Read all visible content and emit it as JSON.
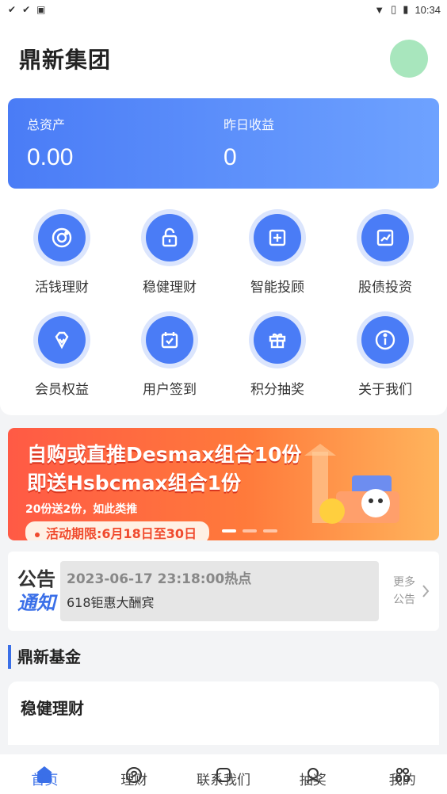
{
  "status_bar": {
    "time": "10:34"
  },
  "header": {
    "title": "鼎新集团"
  },
  "assets": {
    "total_label": "总资产",
    "total_value": "0.00",
    "yesterday_label": "昨日收益",
    "yesterday_value": "0"
  },
  "grid": {
    "items": [
      {
        "label": "活钱理财",
        "icon": "coin-icon"
      },
      {
        "label": "稳健理财",
        "icon": "lock-icon"
      },
      {
        "label": "智能投顾",
        "icon": "plus-box-icon"
      },
      {
        "label": "股债投资",
        "icon": "chart-up-icon"
      },
      {
        "label": "会员权益",
        "icon": "diamond-icon"
      },
      {
        "label": "用户签到",
        "icon": "calendar-check-icon"
      },
      {
        "label": "积分抽奖",
        "icon": "gift-icon"
      },
      {
        "label": "关于我们",
        "icon": "info-icon"
      }
    ]
  },
  "banner": {
    "line1": "自购或直推Desmax组合10份",
    "line2": "即送Hsbcmax组合1份",
    "sub": "20份送2份，如此类推",
    "period": "活动期限:6月18日至30日"
  },
  "notice": {
    "logo_a": "公告",
    "logo_b": "通知",
    "time": "2023-06-17 23:18:00热点",
    "text": "618钜惠大酬宾",
    "more_1": "更多",
    "more_2": "公告"
  },
  "section": {
    "title": "鼎新基金"
  },
  "product": {
    "title": "稳健理财"
  },
  "tabbar": {
    "tabs": [
      {
        "label": "首页",
        "icon": "home-icon"
      },
      {
        "label": "理财",
        "icon": "finance-icon"
      },
      {
        "label": "联系我们",
        "icon": "contact-icon"
      },
      {
        "label": "抽奖",
        "icon": "lottery-icon"
      },
      {
        "label": "我的",
        "icon": "profile-icon"
      }
    ]
  },
  "colors": {
    "primary": "#4a7cf6",
    "accent": "#3a6fe8",
    "banner": "#ff5a45"
  }
}
